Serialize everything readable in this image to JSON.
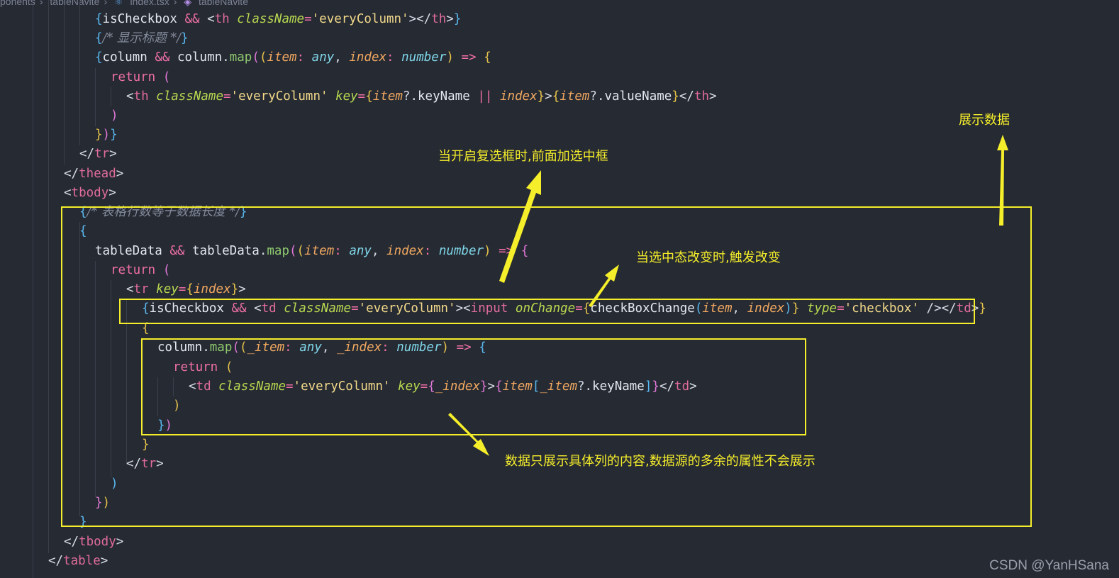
{
  "breadcrumb": {
    "items": [
      "ponents",
      "tableNavite",
      "index.tsx",
      "tableNavite"
    ]
  },
  "code": {
    "lines": [
      "{isCheckbox && <th className='everyColumn'></th>}",
      "{/* 显示标题 */}",
      "{column && column.map((item: any, index: number) => {",
      "return (",
      "<th className='everyColumn' key={item?.keyName || index}>{item?.valueName}</th>",
      ")",
      "})}",
      "</tr>",
      "</thead>",
      "<tbody>",
      "{/* 表格行数等于数据长度 */}",
      "{",
      "tableData && tableData.map((item: any, index: number) => {",
      "return (",
      "<tr key={index}>",
      "{isCheckbox && <td className='everyColumn'><input onChange={checkBoxChange(item, index)} type='checkbox' /></td>}",
      "{",
      "column.map((_item: any, _index: number) => {",
      "return (",
      "<td className='everyColumn' key={_index}>{item[_item?.keyName]}</td>",
      ")",
      "})",
      "}",
      "</tr>",
      ")",
      "})",
      "}",
      "</tbody>",
      "</table>"
    ]
  },
  "annotations": {
    "show_data": "展示数据",
    "checkbox_enabled": "当开启复选框时,前面加选中框",
    "checked_change": "当选中态改变时,触发改变",
    "columns_only": "数据只展示具体列的内容,数据源的多余的属性不会展示"
  },
  "watermark": "CSDN @YanHSana",
  "colors": {
    "background": "#262a33",
    "highlight": "#f5ee2a"
  }
}
